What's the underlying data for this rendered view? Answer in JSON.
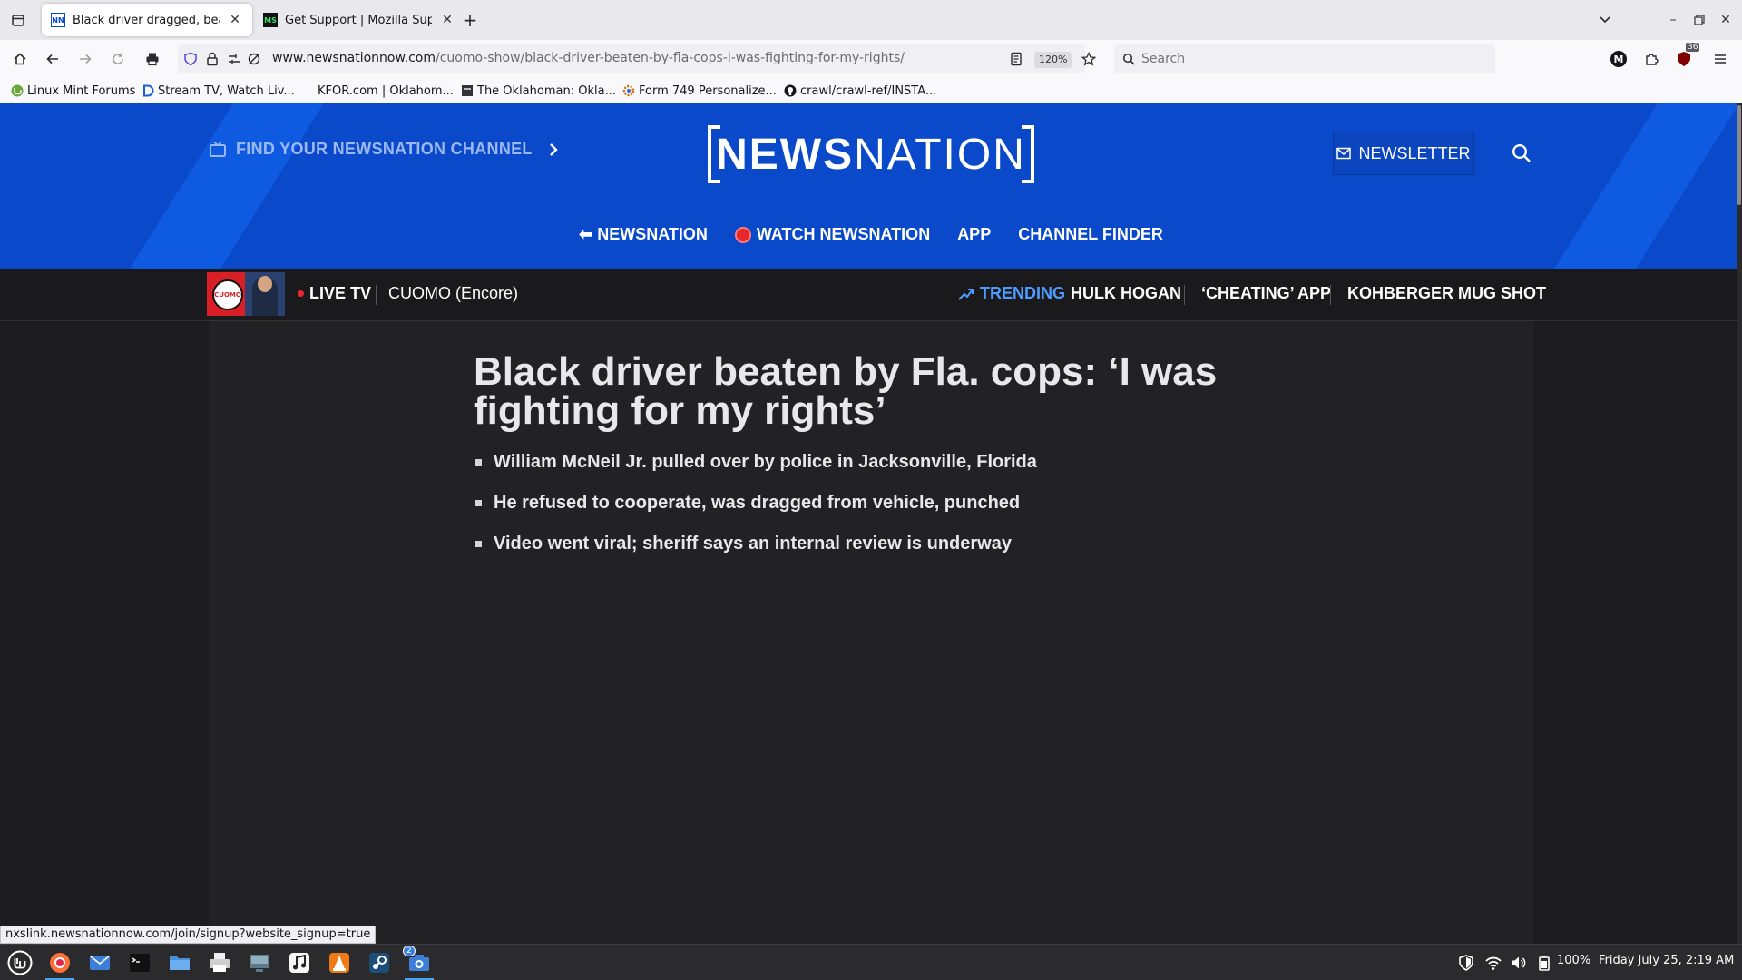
{
  "browser": {
    "tabs": [
      {
        "title": "Black driver dragged, beaten",
        "favicon": "NN",
        "active": true
      },
      {
        "title": "Get Support | Mozilla Support",
        "favicon": "MS",
        "active": false
      }
    ],
    "url": {
      "host": "www.newsnationnow.com",
      "path": "/cuomo-show/black-driver-beaten-by-fla-cops-i-was-fighting-for-my-rights/"
    },
    "zoom": "120%",
    "search_placeholder": "Search",
    "extension_badge": "36",
    "profile_initial": "M",
    "bookmarks": [
      {
        "label": "Linux Mint Forums",
        "icon": "mint-icon"
      },
      {
        "label": "Stream TV, Watch Liv...",
        "icon": "d-icon"
      },
      {
        "label": "KFOR.com | Oklahom...",
        "icon": "none"
      },
      {
        "label": "The Oklahoman: Okla...",
        "icon": "oklahoman-icon"
      },
      {
        "label": "Form 749 Personalize...",
        "icon": "gear-icon"
      },
      {
        "label": "crawl/crawl-ref/INSTA...",
        "icon": "github-icon"
      }
    ],
    "status_link": "nxslink.newsnationnow.com/join/signup?website_signup=true"
  },
  "site": {
    "find_channel": "FIND YOUR NEWSNATION CHANNEL",
    "logo_bold": "NEWS",
    "logo_light": "NATION",
    "newsletter": "NEWSLETTER",
    "nav": [
      "⬅ NEWSNATION",
      "WATCH NEWSNATION",
      "APP",
      "CHANNEL FINDER"
    ],
    "thumb_label": "CUOMO",
    "live_tv": "LIVE TV",
    "show": "CUOMO (Encore)",
    "trending_label": "TRENDING",
    "trending": [
      "HULK HOGAN",
      "‘CHEATING’ APP",
      "KOHBERGER MUG SHOT"
    ]
  },
  "article": {
    "headline": "Black driver beaten by Fla. cops: ‘I was fighting for my rights’",
    "bullets": [
      "William McNeil Jr. pulled over by police in Jacksonville, Florida",
      "He refused to cooperate, was dragged from vehicle, punched",
      "Video went viral; sheriff says an internal review is underway"
    ]
  },
  "taskbar": {
    "battery": "100%",
    "clock": "Friday July 25, 2:19 AM",
    "camera_badge": "2"
  },
  "colors": {
    "brand_blue": "#0a49c9",
    "accent_blue": "#4d9cff",
    "live_red": "#e8272a"
  }
}
